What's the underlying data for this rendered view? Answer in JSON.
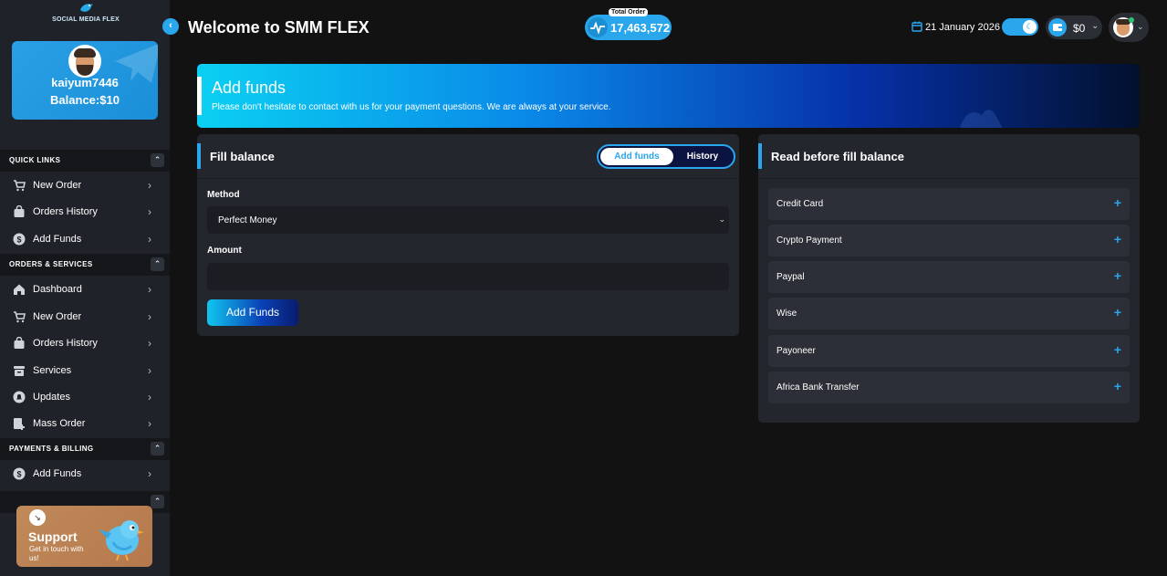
{
  "brand": {
    "logo_text": "SOCIAL MEDIA FLEX"
  },
  "profile": {
    "username": "kaiyum7446",
    "balance": "Balance:$10"
  },
  "sidebar": {
    "sections": [
      {
        "title": "QUICK LINKS",
        "toggle": "⌃"
      },
      {
        "title": "ORDERS & SERVICES",
        "toggle": "⌃"
      },
      {
        "title": "PAYMENTS & BILLING",
        "toggle": "⌃"
      }
    ],
    "quick_links": [
      {
        "label": "New Order",
        "icon": "cart-icon"
      },
      {
        "label": "Orders History",
        "icon": "bag-icon"
      },
      {
        "label": "Add Funds",
        "icon": "dollar-coin-icon"
      }
    ],
    "orders_services": [
      {
        "label": "Dashboard",
        "icon": "home-icon"
      },
      {
        "label": "New Order",
        "icon": "cart-icon"
      },
      {
        "label": "Orders History",
        "icon": "bag-icon"
      },
      {
        "label": "Services",
        "icon": "archive-icon"
      },
      {
        "label": "Updates",
        "icon": "bell-icon"
      },
      {
        "label": "Mass Order",
        "icon": "add-doc-icon"
      }
    ],
    "payments_billing": [
      {
        "label": "Add Funds",
        "icon": "dollar-coin-icon"
      }
    ],
    "chevron": "›"
  },
  "support": {
    "title": "Support",
    "subtitle": "Get in touch with us!",
    "arrow": "↘"
  },
  "header": {
    "title": "Welcome to SMM FLEX",
    "total_order_label": "Total Order",
    "total_order_value": "17,463,572",
    "date": "21 January 2026",
    "wallet_amount": "$0",
    "dropdown_glyph": "⌄"
  },
  "banner": {
    "title": "Add funds",
    "subtitle": "Please don't hesitate to contact with us for your payment questions. We are always at your service."
  },
  "fill_balance": {
    "title": "Fill balance",
    "tabs": [
      "Add funds",
      "History"
    ],
    "method_label": "Method",
    "method_value": "Perfect Money",
    "amount_label": "Amount",
    "amount_value": "",
    "submit_label": "Add Funds"
  },
  "read_before": {
    "title": "Read before fill balance",
    "items": [
      "Credit Card",
      "Crypto Payment",
      "Paypal",
      "Wise",
      "Payoneer",
      "Africa Bank Transfer"
    ],
    "plus_glyph": "+"
  },
  "colors": {
    "accent": "#2aa6ec",
    "sidebar_bg": "#1f2228",
    "card_bg": "#23262d",
    "page_bg": "#121212"
  }
}
